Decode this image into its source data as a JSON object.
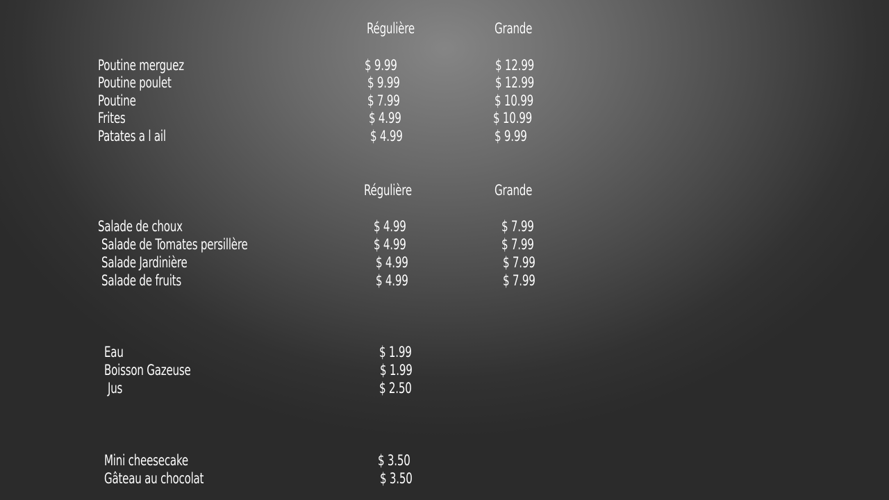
{
  "poutines": {
    "headers": {
      "regular": "Régulière",
      "large": "Grande"
    },
    "items": [
      {
        "name": "Poutine merguez",
        "regular": "$ 9.99",
        "large": "$ 12.99"
      },
      {
        "name": "Poutine poulet",
        "regular": "$ 9.99",
        "large": "$ 12.99"
      },
      {
        "name": "Poutine",
        "regular": "$ 7.99",
        "large": "$ 10.99"
      },
      {
        "name": "Frites",
        "regular": "$ 4.99",
        "large": "$ 10.99"
      },
      {
        "name": "Patates a l ail",
        "regular": "$ 4.99",
        "large": "$ 9.99"
      }
    ]
  },
  "salades": {
    "headers": {
      "regular": "Régulière",
      "large": "Grande"
    },
    "items": [
      {
        "name": "Salade de choux",
        "regular": "$ 4.99",
        "large": "$ 7.99"
      },
      {
        "name": "Salade de Tomates persillère",
        "regular": "$ 4.99",
        "large": "$ 7.99"
      },
      {
        "name": "Salade Jardinière",
        "regular": "$ 4.99",
        "large": "$ 7.99"
      },
      {
        "name": "Salade de fruits",
        "regular": "$ 4.99",
        "large": "$ 7.99"
      }
    ]
  },
  "boissons": {
    "items": [
      {
        "name": "Eau",
        "price": "$ 1.99"
      },
      {
        "name": "Boisson Gazeuse",
        "price": "$ 1.99"
      },
      {
        "name": "Jus",
        "price": "$ 2.50"
      }
    ]
  },
  "desserts": {
    "items": [
      {
        "name": "Mini cheesecake",
        "price": "$ 3.50"
      },
      {
        "name": "Gâteau au chocolat",
        "price": "$ 3.50"
      }
    ]
  }
}
